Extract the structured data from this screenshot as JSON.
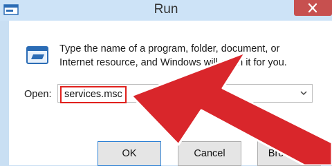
{
  "window": {
    "title": "Run"
  },
  "dialog": {
    "description": "Type the name of a program, folder, document, or Internet resource, and Windows will open it for you.",
    "open_label": "Open:",
    "command_value": "services.msc",
    "buttons": {
      "ok": "OK",
      "cancel": "Cancel",
      "browse": "Browse..."
    }
  },
  "colors": {
    "titlebar": "#cde3f7",
    "close_button": "#c7504f",
    "highlight": "#e0201c",
    "arrow": "#d9262b"
  },
  "icons": [
    "app-icon",
    "close-icon",
    "run-icon",
    "chevron-down-icon",
    "red-arrow-annotation"
  ]
}
